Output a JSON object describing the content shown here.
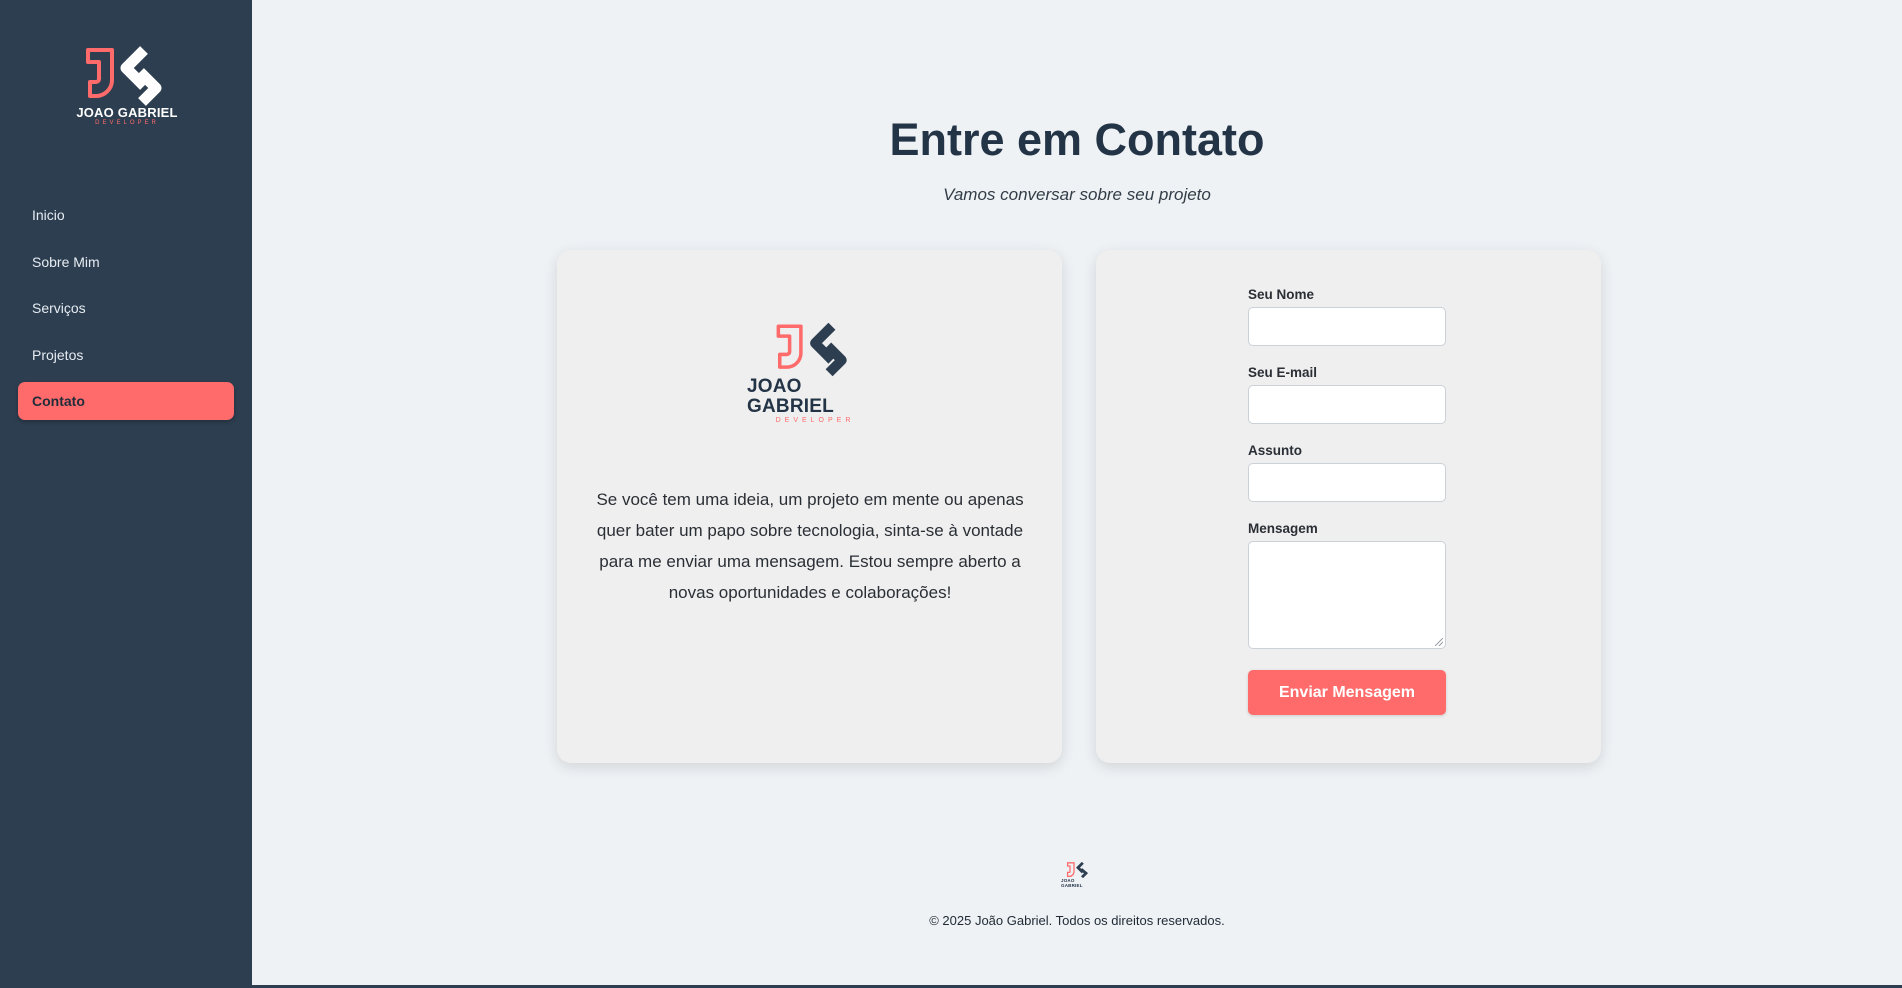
{
  "sidebar": {
    "logo": {
      "name": "JOAO GABRIEL",
      "sub": "DEVELOPER"
    },
    "items": [
      {
        "label": "Inicio"
      },
      {
        "label": "Sobre Mim"
      },
      {
        "label": "Serviços"
      },
      {
        "label": "Projetos"
      },
      {
        "label": "Contato",
        "active": true
      }
    ]
  },
  "main": {
    "title": "Entre em Contato",
    "subtitle": "Vamos conversar sobre seu projeto",
    "info_card": {
      "logo": {
        "name": "JOAO GABRIEL",
        "sub": "DEVELOPER"
      },
      "text": "Se você tem uma ideia, um projeto em mente ou apenas quer bater um papo sobre tecnologia, sinta-se à vontade para me enviar uma mensagem. Estou sempre aberto a novas oportunidades e colaborações!"
    },
    "form": {
      "name_label": "Seu Nome",
      "name_value": "",
      "email_label": "Seu E-mail",
      "email_value": "",
      "subject_label": "Assunto",
      "subject_value": "",
      "message_label": "Mensagem",
      "message_value": "",
      "submit_label": "Enviar Mensagem"
    }
  },
  "footer": {
    "logo": {
      "name": "JOAO GABRIEL"
    },
    "copyright": "© 2025 João Gabriel. Todos os direitos reservados."
  },
  "colors": {
    "accent": "#ff6b6b",
    "sidebar": "#2d3e50",
    "heading": "#243447",
    "background": "#eef2f5"
  }
}
